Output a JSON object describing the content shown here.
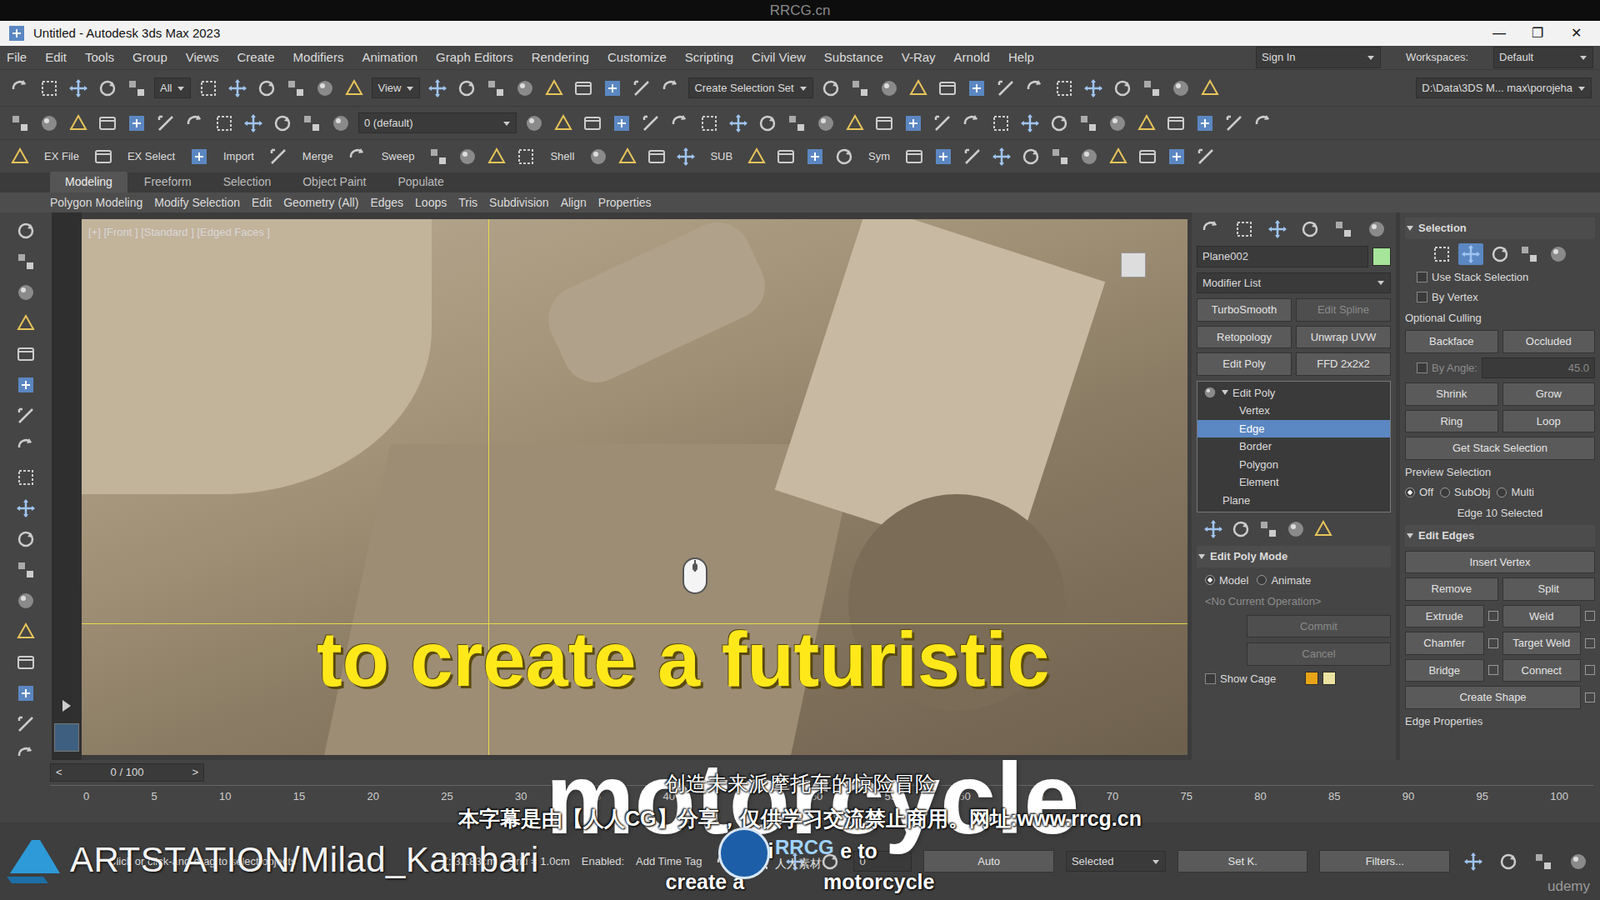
{
  "watermark_top": "RRCG.cn",
  "window": {
    "title": "Untitled - Autodesk 3ds Max 2023",
    "controls": [
      "—",
      "❐",
      "✕"
    ]
  },
  "menu": [
    "File",
    "Edit",
    "Tools",
    "Group",
    "Views",
    "Create",
    "Modifiers",
    "Animation",
    "Graph Editors",
    "Rendering",
    "Customize",
    "Scripting",
    "Civil View",
    "Substance",
    "V-Ray",
    "Arnold",
    "Help"
  ],
  "sign_in": "Sign In",
  "workspaces": {
    "label": "Workspaces:",
    "value": "Default"
  },
  "toolbar1": {
    "filter": "All",
    "view": "View",
    "selection_set": "Create Selection Set",
    "path": "D:\\Data\\3DS M... max\\porojeha"
  },
  "toolbar2": {
    "layer": "0 (default)"
  },
  "toolbar3": [
    "EX File",
    "EX Select",
    "Import",
    "Merge",
    "Sweep",
    "Shell",
    "SUB",
    "Sym"
  ],
  "ribbon": {
    "tabs": [
      {
        "label": "Modeling",
        "selected": true
      },
      {
        "label": "Freeform",
        "selected": false
      },
      {
        "label": "Selection",
        "selected": false
      },
      {
        "label": "Object Paint",
        "selected": false
      },
      {
        "label": "Populate",
        "selected": false
      }
    ],
    "groups": [
      "Polygon Modeling",
      "Modify Selection",
      "Edit",
      "Geometry (All)",
      "Edges",
      "Loops",
      "Tris",
      "Subdivision",
      "Align",
      "Properties"
    ]
  },
  "viewport": {
    "label": "[+] [Front ] [Standard ] [Edged Faces ]"
  },
  "command_panel": {
    "object_name": "Plane002",
    "object_color": "#a6e59a",
    "modifier_list": "Modifier List",
    "modifier_buttons": [
      {
        "label": "TurboSmooth",
        "disabled": false
      },
      {
        "label": "Edit Spline",
        "disabled": true
      },
      {
        "label": "Retopology",
        "disabled": false
      },
      {
        "label": "Unwrap UVW",
        "disabled": false
      },
      {
        "label": "Edit Poly",
        "disabled": false
      },
      {
        "label": "FFD 2x2x2",
        "disabled": false
      }
    ],
    "stack": [
      {
        "label": "Edit Poly",
        "kind": "modifier",
        "expanded": true,
        "selected": false
      },
      {
        "label": "Vertex",
        "kind": "sub",
        "selected": false
      },
      {
        "label": "Edge",
        "kind": "sub",
        "selected": true
      },
      {
        "label": "Border",
        "kind": "sub",
        "selected": false
      },
      {
        "label": "Polygon",
        "kind": "sub",
        "selected": false
      },
      {
        "label": "Element",
        "kind": "sub",
        "selected": false
      },
      {
        "label": "Plane",
        "kind": "base",
        "selected": false
      }
    ],
    "edit_poly_mode": {
      "title": "Edit Poly Mode",
      "expanded": true,
      "options": [
        {
          "label": "Model",
          "selected": true
        },
        {
          "label": "Animate",
          "selected": false
        }
      ],
      "operation": "<No Current Operation>",
      "commit": {
        "label": "Commit",
        "disabled": true
      },
      "cancel": {
        "label": "Cancel",
        "disabled": true
      },
      "show_cage": {
        "label": "Show Cage",
        "checked": false
      },
      "cage_colors": [
        "#e8a317",
        "#ece3a0"
      ]
    }
  },
  "selection_panel": {
    "title": "Selection",
    "expanded": true,
    "subobjects": [
      {
        "selected": false
      },
      {
        "selected": true
      },
      {
        "selected": false
      },
      {
        "selected": false
      },
      {
        "selected": false
      }
    ],
    "checks": [
      {
        "label": "Use Stack Selection",
        "checked": false
      },
      {
        "label": "By Vertex",
        "checked": false
      }
    ],
    "culling_label": "Optional Culling",
    "culling": [
      {
        "label": "Backface"
      },
      {
        "label": "Occluded"
      }
    ],
    "by_angle": {
      "label": "By Angle:",
      "value": "45.0",
      "disabled": true
    },
    "grow": [
      "Shrink",
      "Grow"
    ],
    "ring_loop": [
      "Ring",
      "Loop"
    ],
    "get_stack": "Get Stack Selection",
    "preview_label": "Preview Selection",
    "preview": [
      {
        "label": "Off",
        "selected": true
      },
      {
        "label": "SubObj",
        "selected": false
      },
      {
        "label": "Multi",
        "selected": false
      }
    ],
    "info": "Edge 10 Selected",
    "edit_edges": {
      "title": "Edit Edges",
      "expanded": true,
      "rows": [
        [
          "Insert Vertex"
        ],
        [
          "Remove",
          "Split"
        ],
        [
          "Extrude",
          "Weld"
        ],
        [
          "Chamfer",
          "Target Weld"
        ],
        [
          "Bridge",
          "Connect"
        ],
        [
          "Create Shape"
        ]
      ],
      "footer": "Edge Properties"
    }
  },
  "timeline": {
    "position": "0 / 100",
    "prev": "<",
    "next": ">",
    "ticks": [
      "0",
      "5",
      "10",
      "15",
      "20",
      "25",
      "30",
      "35",
      "40",
      "45",
      "50",
      "55",
      "60",
      "65",
      "70",
      "75",
      "80",
      "85",
      "90",
      "95",
      "100"
    ]
  },
  "status": {
    "prompt": "Click or click-and-drag to select objects",
    "z": "Z: 3.183cm",
    "grid": "Grid = 1.0cm",
    "enabled": "Enabled:",
    "add_time_tag": "Add Time Tag",
    "auto": "Auto",
    "key_mode": "Selected",
    "set_key": "Set K.",
    "filters": "Filters...",
    "frame": "0"
  },
  "overlays": {
    "title_line1": "to create a futuristic",
    "title_line2": "motorcycle",
    "cn_line1": "创造未来派摩托车的惊险冒险",
    "cn_line2": "本字幕是由【人人CG】分享，仅供学习交流禁止商用。网址:www.rrcg.cn",
    "en_line1": [
      "a thri",
      "e to"
    ],
    "en_line2": [
      "create a ",
      "motorcycle"
    ],
    "logo": {
      "text": "RRCG",
      "subtext": "人人素材"
    },
    "artstation": "ARTSTATION/Milad_Kambari",
    "udemy": "udemy"
  }
}
